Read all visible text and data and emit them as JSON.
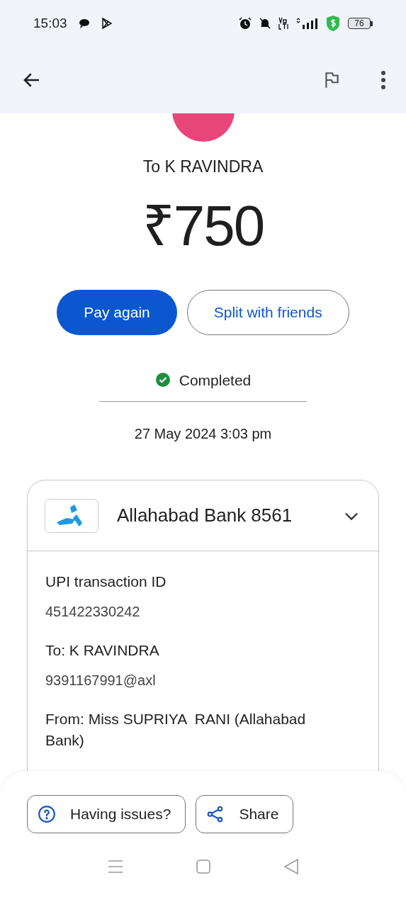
{
  "status_bar": {
    "time": "15:03",
    "battery": "76"
  },
  "payee": {
    "name": "To K RAVINDRA",
    "amount": "₹750"
  },
  "actions": [
    {
      "label": "Pay again",
      "kind": "primary"
    },
    {
      "label": "Split with friends",
      "kind": "outline"
    }
  ],
  "status": {
    "label": "Completed",
    "completed": true
  },
  "date": "27 May 2024 3:03 pm",
  "account": {
    "name": "Allahabad Bank 8561",
    "expanded": true
  },
  "details": [
    {
      "label": "UPI transaction ID",
      "value": "451422330242"
    },
    {
      "label": "To: K RAVINDRA",
      "value": "9391167991@axl"
    },
    {
      "label": "From: Miss SUPRIYA  RANI (Allahabad Bank)"
    }
  ],
  "bottom_buttons": [
    {
      "label": "Having issues?",
      "kind": "help"
    },
    {
      "label": "Share",
      "kind": "share"
    }
  ]
}
